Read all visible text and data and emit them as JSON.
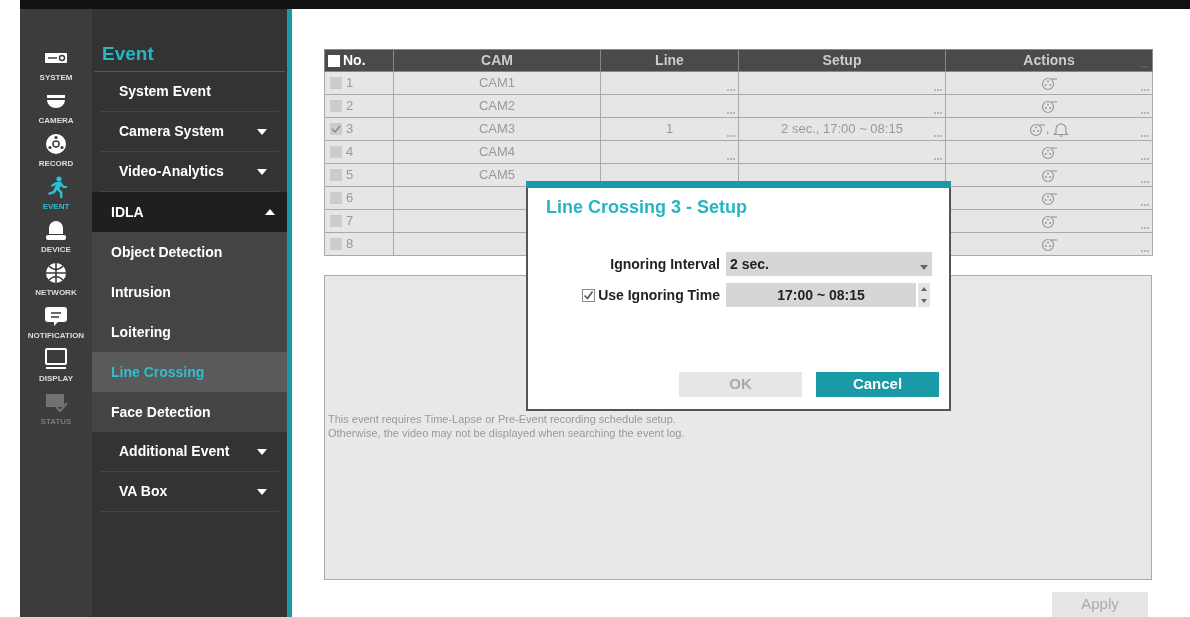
{
  "rail": [
    {
      "kind": "system",
      "label": "SYSTEM",
      "selected": false,
      "disabled": false
    },
    {
      "kind": "camera",
      "label": "CAMERA",
      "selected": false,
      "disabled": false
    },
    {
      "kind": "record",
      "label": "RECORD",
      "selected": false,
      "disabled": false
    },
    {
      "kind": "event",
      "label": "EVENT",
      "selected": true,
      "disabled": false
    },
    {
      "kind": "device",
      "label": "DEVICE",
      "selected": false,
      "disabled": false
    },
    {
      "kind": "network",
      "label": "NETWORK",
      "selected": false,
      "disabled": false
    },
    {
      "kind": "notification",
      "label": "NOTIFICATION",
      "selected": false,
      "disabled": false
    },
    {
      "kind": "display",
      "label": "DISPLAY",
      "selected": false,
      "disabled": false
    },
    {
      "kind": "status",
      "label": "STATUS",
      "selected": false,
      "disabled": true
    }
  ],
  "menu": {
    "title": "Event",
    "items": [
      {
        "label": "System Event",
        "selected": false
      },
      {
        "label": "Camera System",
        "selected": false,
        "expanded": false
      },
      {
        "label": "Video-Analytics",
        "selected": false,
        "expanded": false
      },
      {
        "label": "IDLA",
        "selected": false,
        "expanded": true,
        "children": [
          {
            "label": "Object Detection",
            "selected": false
          },
          {
            "label": "Intrusion",
            "selected": false
          },
          {
            "label": "Loitering",
            "selected": false
          },
          {
            "label": "Line Crossing",
            "selected": true
          },
          {
            "label": "Face Detection",
            "selected": false
          }
        ]
      },
      {
        "label": "Additional Event",
        "selected": false,
        "expanded": false
      },
      {
        "label": "VA Box",
        "selected": false,
        "expanded": false
      }
    ]
  },
  "table": {
    "columns": [
      "No.",
      "CAM",
      "Line",
      "Setup",
      "Actions"
    ],
    "header_checked": false,
    "rows": [
      {
        "no": "1",
        "checked": false,
        "cam": "CAM1",
        "actions": [
          {
            "kind": "record"
          }
        ]
      },
      {
        "no": "2",
        "checked": false,
        "cam": "CAM2",
        "actions": [
          {
            "kind": "record"
          }
        ]
      },
      {
        "no": "3",
        "checked": true,
        "cam": "CAM3",
        "line": "1",
        "setup": "2 sec., 17:00 ~ 08:15",
        "actions": [
          {
            "kind": "record"
          },
          {
            "kind": "alarm"
          }
        ],
        "actions_separator": ","
      },
      {
        "no": "4",
        "checked": false,
        "cam": "CAM4",
        "actions": [
          {
            "kind": "record"
          }
        ]
      },
      {
        "no": "5",
        "checked": false,
        "cam": "CAM5",
        "actions": [
          {
            "kind": "record"
          }
        ]
      },
      {
        "no": "6",
        "checked": false,
        "actions": [
          {
            "kind": "record"
          }
        ]
      },
      {
        "no": "7",
        "checked": false,
        "actions": [
          {
            "kind": "record"
          }
        ]
      },
      {
        "no": "8",
        "checked": false,
        "actions": [
          {
            "kind": "record"
          }
        ]
      }
    ]
  },
  "notes": [
    "This event requires Time-Lapse or Pre-Event recording schedule setup.",
    "Otherwise, the video may not be displayed when searching the event log."
  ],
  "apply_button": "Apply",
  "dialog": {
    "title": "Line Crossing 3 - Setup",
    "interval_label": "Ignoring Interval",
    "interval_value": "2 sec.",
    "time_label": "Use Ignoring Time",
    "time_checked": true,
    "time_value": "17:00 ~ 08:15",
    "ok": "OK",
    "ok_disabled": true,
    "cancel": "Cancel"
  }
}
